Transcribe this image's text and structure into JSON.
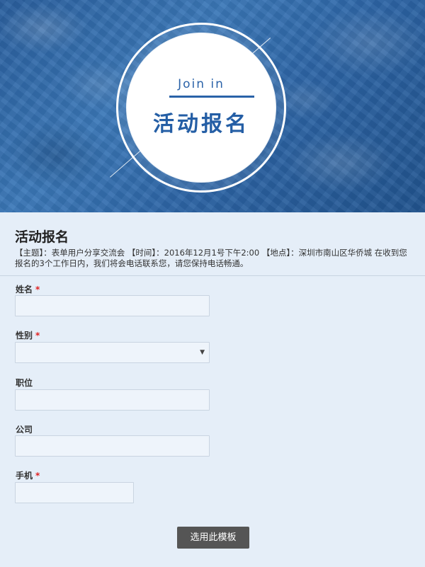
{
  "hero": {
    "join_text": "Join  in",
    "title": "活动报名"
  },
  "form": {
    "title": "活动报名",
    "description": "【主题】：表单用户分享交流会 【时间】：2016年12月1号下午2:00 【地点】：深圳市南山区华侨城 在收到您报名的3个工作日内，我们将会电话联系您，请您保持电话畅通。",
    "required_mark": "*",
    "fields": [
      {
        "label": "姓名",
        "required": true,
        "type": "text",
        "value": ""
      },
      {
        "label": "性别",
        "required": true,
        "type": "select",
        "value": "",
        "arrow": "▼"
      },
      {
        "label": "职位",
        "required": false,
        "type": "text",
        "value": ""
      },
      {
        "label": "公司",
        "required": false,
        "type": "text",
        "value": ""
      },
      {
        "label": "手机",
        "required": true,
        "type": "text",
        "value": ""
      }
    ],
    "submit_label": "选用此模板"
  },
  "colors": {
    "accent": "#2a62a8",
    "background": "#e5eef8",
    "required": "#e02020",
    "button": "#555555"
  }
}
